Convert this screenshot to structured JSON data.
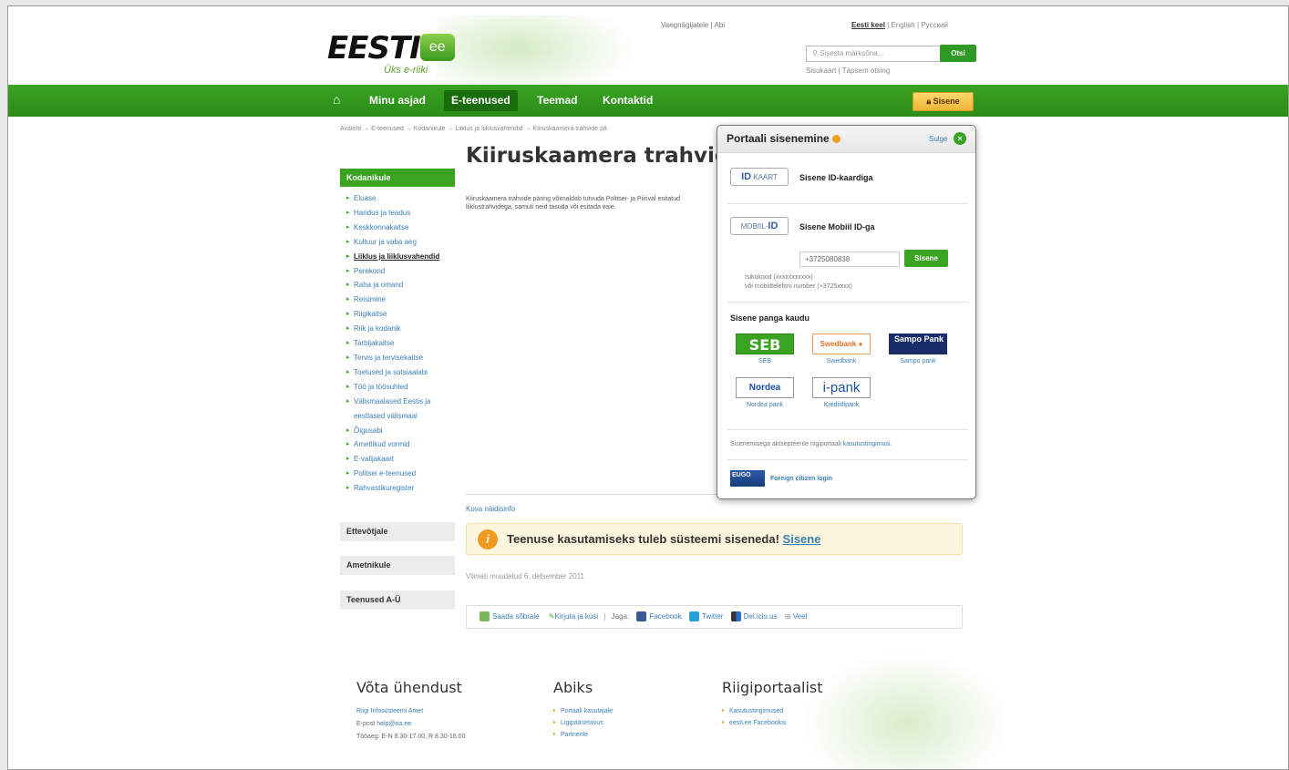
{
  "header": {
    "logo_text": "EESTI",
    "logo_badge": "ee",
    "logo_sub": "Üks e-riiki",
    "top_links": [
      "Vaegnägijatele",
      "Abi"
    ],
    "languages": [
      "Eesti keel",
      "English",
      "Русский"
    ],
    "search_placeholder": "Sisesta märksõna...",
    "search_button": "Otsi",
    "sub_links": [
      "Sisukaart",
      "Täpsem otsing"
    ]
  },
  "nav": {
    "home_icon": "home-icon",
    "items": [
      "Minu asjad",
      "E-teenused",
      "Teemad",
      "Kontaktid"
    ],
    "active": "E-teenused",
    "login_button": "Sisene"
  },
  "breadcrumb": "Avaleht → E-teenused → Kodanikule → Liiklus ja liiklusvahendid → Kiiruskaamera trahvide pä",
  "sidebar": {
    "heading": "Kodanikule",
    "items": [
      "Eluase",
      "Haridus ja teadus",
      "Keskkonnakaitse",
      "Kultuur ja vaba aeg",
      "Liiklus ja liiklusvahendid",
      "Perekond",
      "Raha ja omand",
      "Reisimine",
      "Riigikaitse",
      "Riik ja kodanik",
      "Tarbijakaitse",
      "Tervis ja tervisekaitse",
      "Toetused ja sotsiaalabi",
      "Töö ja töösuhted",
      "Välismaalased Eestis ja eestlased välismaal",
      "Õigusabi",
      "Ametlikud vormid",
      "E-valijakaart",
      "Politsei e-teenused",
      "Rahvastikuregister"
    ],
    "active_item": "Liiklus ja liiklusvahendid",
    "boxes": [
      "Ettevõtjale",
      "Ametnikule",
      "Teenused A-Ü"
    ]
  },
  "main": {
    "title": "Kiiruskaamera trahvide",
    "intro": "Kiiruskaamera trahvide päring võimaldab tutvuda Politsei- ja Piirival esitatud liiklustrahvidega, samuti neid tasuda või esitada vaie.",
    "sample_link": "Kuva näidisinfo",
    "notice_text": "Teenuse kasutamiseks tuleb süsteemi siseneda!",
    "notice_link": "Sisene",
    "modified": "Viimati muudetud 6. detsember 2011",
    "share": {
      "send": "Saada sõbrale",
      "write": "Kirjuta ja küsi",
      "share_label": "Jaga:",
      "facebook": "Facebook",
      "twitter": "Twitter",
      "delicious": "Del.icio.us",
      "more": "Veel"
    }
  },
  "popup": {
    "title": "Portaali sisenemine",
    "close_label": "Sulge",
    "id_logo": "KAART",
    "id_logo_mark": "ID",
    "id_label": "Sisene ID-kaardiga",
    "mobile_logo": "MOBIIL-",
    "mobile_logo_mark": "ID",
    "mobile_label": "Sisene Mobiil ID-ga",
    "phone_value": "+3725080838",
    "mobile_button": "Sisene",
    "hint_line1": "Isikukood (xxxxxxxxxxx)",
    "hint_line2": "või mobiiltelefoni number (+3725xxxx)",
    "bank_heading": "Sisene panga kaudu",
    "banks": [
      {
        "logo": "SEB",
        "name": "SEB"
      },
      {
        "logo": "Swedbank",
        "name": "Swedbank"
      },
      {
        "logo": "Sampo Pank",
        "name": "Sampo pank"
      },
      {
        "logo": "Nordea",
        "name": "Nordea pank"
      },
      {
        "logo": "i-pank",
        "name": "Krediidipank"
      }
    ],
    "terms_text": "Sisenemisega aktsepteerite riigiportaali",
    "terms_link": "kasutustingimusi.",
    "eugo_logo": "EUGO",
    "foreign_login": "Foreign citizen login"
  },
  "footer": {
    "contact_heading": "Võta ühendust",
    "contact_org": "Riigi Infosüsteemi Amet",
    "contact_email_label": "E-post",
    "contact_email": "help@ria.ee",
    "contact_hours": "Tööaeg: E-N 8.30-17.00, R 8.30-16.00",
    "help_heading": "Abiks",
    "help_links": [
      "Portaali kasutajale",
      "Ligipääsetavus",
      "Partnerile"
    ],
    "portal_heading": "Riigiportaalist",
    "portal_links": [
      "Kasutustingimused",
      "eesti.ee Facebookis"
    ]
  },
  "colors": {
    "brand_green": "#3aa322",
    "accent_orange": "#f0a020",
    "link_blue": "#3a7fb8"
  }
}
